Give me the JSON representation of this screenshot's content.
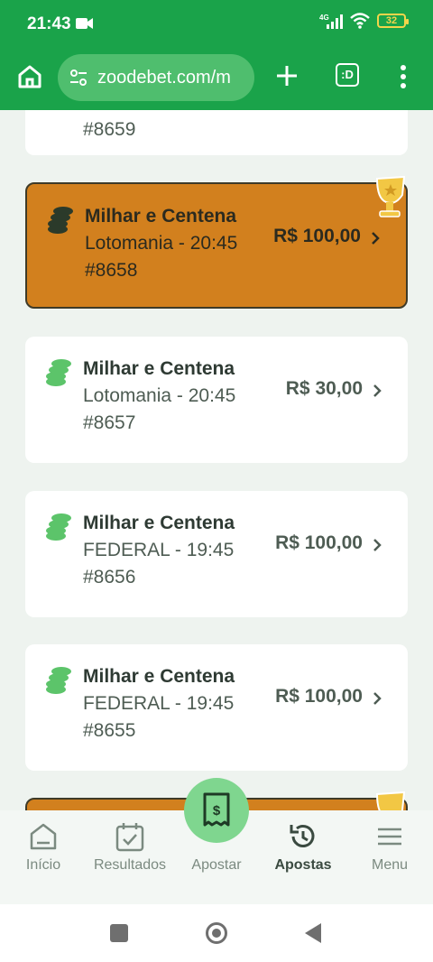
{
  "status": {
    "time": "21:43",
    "network": "4G",
    "battery": "32"
  },
  "browser": {
    "url": "zoodebet.com/m",
    "tab_count": ":D"
  },
  "bets": [
    {
      "id": "#8659",
      "winner": false
    },
    {
      "title": "Milhar e Centena",
      "lottery": "Lotomania - 20:45",
      "id": "#8658",
      "amount": "R$ 100,00",
      "winner": true
    },
    {
      "title": "Milhar e Centena",
      "lottery": "Lotomania - 20:45",
      "id": "#8657",
      "amount": "R$ 30,00",
      "winner": false
    },
    {
      "title": "Milhar e Centena",
      "lottery": "FEDERAL - 19:45",
      "id": "#8656",
      "amount": "R$ 100,00",
      "winner": false
    },
    {
      "title": "Milhar e Centena",
      "lottery": "FEDERAL - 19:45",
      "id": "#8655",
      "amount": "R$ 100,00",
      "winner": false
    }
  ],
  "nav": {
    "inicio": "Início",
    "resultados": "Resultados",
    "apostar": "Apostar",
    "apostas": "Apostas",
    "menu": "Menu"
  },
  "colors": {
    "brand": "#1aa34a",
    "winner": "#d2801e",
    "coin": "#5cc46a",
    "coin_winner": "#2b3a2a"
  }
}
